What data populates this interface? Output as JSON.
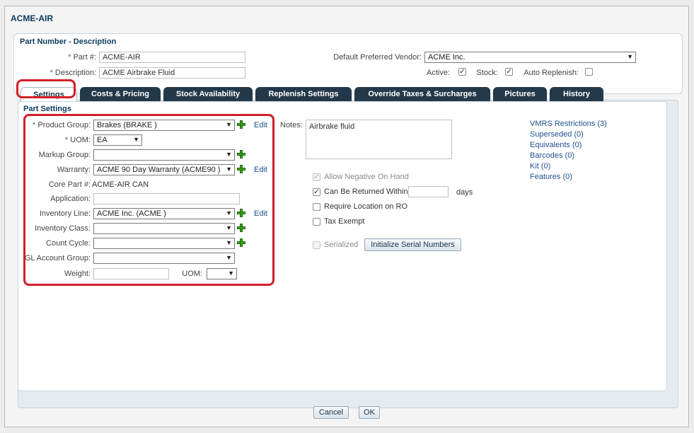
{
  "window": {
    "title": "ACME-AIR"
  },
  "header": {
    "section_title": "Part Number - Description",
    "part_label": "Part #:",
    "part_value": "ACME-AIR",
    "description_label": "Description:",
    "description_value": "ACME Airbrake Fluid",
    "vendor_label": "Default Preferred Vendor:",
    "vendor_value": "ACME Inc.",
    "active_label": "Active:",
    "stock_label": "Stock:",
    "auto_replenish_label": "Auto Replenish:",
    "required_mark": "*"
  },
  "tabs": [
    {
      "label": "Settings",
      "active": true
    },
    {
      "label": "Costs & Pricing"
    },
    {
      "label": "Stock Availability"
    },
    {
      "label": "Replenish Settings"
    },
    {
      "label": "Override Taxes & Surcharges"
    },
    {
      "label": "Pictures"
    },
    {
      "label": "History"
    }
  ],
  "settings": {
    "section_title": "Part Settings",
    "product_group_label": "Product Group:",
    "product_group_value": "Brakes (BRAKE )",
    "uom_label": "UOM:",
    "uom_value": "EA",
    "markup_group_label": "Markup Group:",
    "markup_group_value": "",
    "warranty_label": "Warranty:",
    "warranty_value": "ACME 90 Day Warranty (ACME90 )",
    "core_part_label": "Core Part #:",
    "core_part_value": "ACME-AIR CAN",
    "application_label": "Application:",
    "application_value": "",
    "inventory_line_label": "Inventory Line:",
    "inventory_line_value": "ACME Inc. (ACME )",
    "inventory_class_label": "Inventory Class:",
    "count_cycle_label": "Count Cycle:",
    "gl_account_group_label": "GL Account Group:",
    "weight_label": "Weight:",
    "weight_uom_label": "UOM:",
    "edit_label": "Edit",
    "required_mark": "*"
  },
  "notes": {
    "label": "Notes:",
    "value": "Airbrake fluid"
  },
  "options": {
    "allow_negative": "Allow Negative On Hand",
    "can_be_returned": "Can Be Returned Within",
    "days": "days",
    "require_location": "Require Location on RO",
    "tax_exempt": "Tax Exempt",
    "serialized": "Serialized",
    "init_serial_button": "Initialize Serial Numbers"
  },
  "links": [
    {
      "label": "VMRS Restrictions (3)"
    },
    {
      "label": "Superseded (0)"
    },
    {
      "label": "Equivalents (0)"
    },
    {
      "label": "Barcodes (0)"
    },
    {
      "label": "Kit (0)"
    },
    {
      "label": "Features (0)"
    }
  ],
  "footer": {
    "cancel": "Cancel",
    "ok": "OK"
  },
  "colors": {
    "tab_bg": "#23394b",
    "highlight": "#d3202a",
    "add_icon": "#3aa31a",
    "link": "#1f4f8e"
  }
}
